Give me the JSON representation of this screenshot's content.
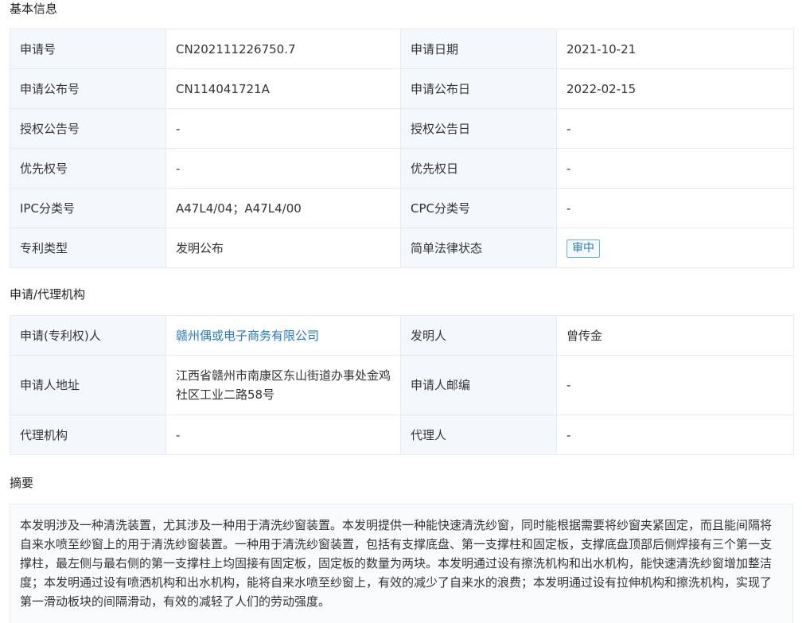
{
  "basic": {
    "title": "基本信息",
    "rows": [
      {
        "l1": "申请号",
        "v1": "CN202111226750.7",
        "l2": "申请日期",
        "v2": "2021-10-21"
      },
      {
        "l1": "申请公布号",
        "v1": "CN114041721A",
        "l2": "申请公布日",
        "v2": "2022-02-15"
      },
      {
        "l1": "授权公告号",
        "v1": "-",
        "l2": "授权公告日",
        "v2": "-"
      },
      {
        "l1": "优先权号",
        "v1": "-",
        "l2": "优先权日",
        "v2": "-"
      },
      {
        "l1": "IPC分类号",
        "v1": "A47L4/04；A47L4/00",
        "l2": "CPC分类号",
        "v2": "-"
      },
      {
        "l1": "专利类型",
        "v1": "发明公布",
        "l2": "简单法律状态",
        "v2": "审中"
      }
    ]
  },
  "agency": {
    "title": "申请/代理机构",
    "rows": [
      {
        "l1": "申请(专利权)人",
        "v1": "赣州偶或电子商务有限公司",
        "l2": "发明人",
        "v2": "曾传金"
      },
      {
        "l1": "申请人地址",
        "v1": "江西省赣州市南康区东山街道办事处金鸡社区工业二路58号",
        "l2": "申请人邮编",
        "v2": "-"
      },
      {
        "l1": "代理机构",
        "v1": "-",
        "l2": "代理人",
        "v2": "-"
      }
    ]
  },
  "abstract": {
    "title": "摘要",
    "text": "本发明涉及一种清洗装置，尤其涉及一种用于清洗纱窗装置。本发明提供一种能快速清洗纱窗，同时能根据需要将纱窗夹紧固定，而且能间隔将自来水喷至纱窗上的用于清洗纱窗装置。一种用于清洗纱窗装置，包括有支撑底盘、第一支撑柱和固定板，支撑底盘顶部后侧焊接有三个第一支撑柱，最左侧与最右侧的第一支撑柱上均固接有固定板，固定板的数量为两块。本发明通过设有擦洗机构和出水机构，能快速清洗纱窗增加整洁度；本发明通过设有喷洒机构和出水机构，能将自来水喷至纱窗上，有效的减少了自来水的浪费；本发明通过设有拉伸机构和擦洗机构，实现了第一滑动板块的间隔滑动，有效的减轻了人们的劳动强度。"
  }
}
